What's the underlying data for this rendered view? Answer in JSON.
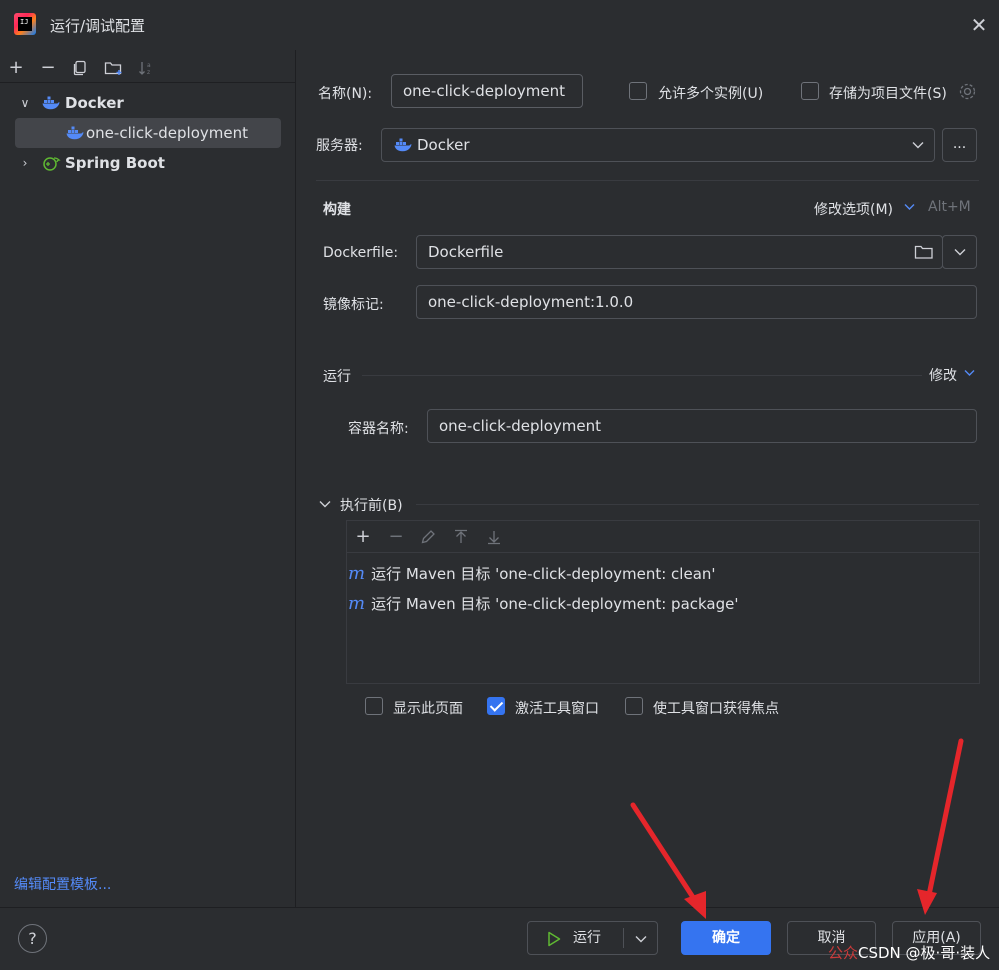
{
  "window": {
    "title": "运行/调试配置",
    "logo_text": "IJ"
  },
  "left_panel": {
    "tree": [
      {
        "label": "Docker",
        "expanded": true
      },
      {
        "label": "one-click-deployment",
        "selected": true
      },
      {
        "label": "Spring Boot",
        "expanded": false
      }
    ],
    "edit_templates_link": "编辑配置模板..."
  },
  "form": {
    "name_label": "名称(N):",
    "name_value": "one-click-deployment",
    "allow_multiple_label": "允许多个实例(U)",
    "store_as_project_label": "存储为项目文件(S)",
    "server_label": "服务器:",
    "server_value": "Docker",
    "server_more": "...",
    "build_section": "构建",
    "modify_options": "修改选项(M)",
    "modify_options_shortcut": "Alt+M",
    "dockerfile_label": "Dockerfile:",
    "dockerfile_value": "Dockerfile",
    "image_tag_label": "镜像标记:",
    "image_tag_value": "one-click-deployment:1.0.0",
    "run_section": "运行",
    "run_modify": "修改",
    "container_name_label": "容器名称:",
    "container_name_value": "one-click-deployment",
    "before_launch_label": "执行前(B)",
    "before_launch_tasks": [
      "运行 Maven 目标 'one-click-deployment: clean'",
      "运行 Maven 目标 'one-click-deployment: package'"
    ],
    "maven_glyph": "m",
    "show_page_label": "显示此页面",
    "activate_tool_window_label": "激活工具窗口",
    "focus_tool_window_label": "使工具窗口获得焦点"
  },
  "footer": {
    "help": "?",
    "run_label": "运行",
    "ok_label": "确定",
    "cancel_label": "取消",
    "apply_label": "应用(A)"
  },
  "watermark": {
    "prefix": "公众",
    "text": "CSDN @极·哥·装",
    "suffix": "人"
  },
  "colors": {
    "background": "#2b2d30",
    "accent": "#3574f0",
    "link": "#548af7",
    "arrow": "#e5262b"
  }
}
